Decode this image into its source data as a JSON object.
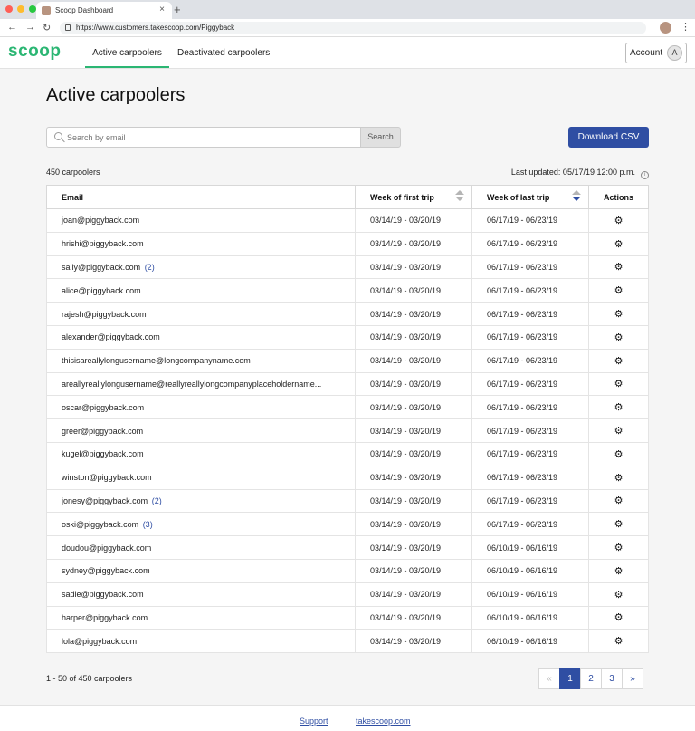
{
  "browser": {
    "tab_title": "Scoop Dashboard",
    "url": "https://www.customers.takescoop.com/Piggyback",
    "new_tab": "+",
    "close": "×",
    "back": "←",
    "forward": "→",
    "reload": "↻",
    "menu": "⋮"
  },
  "header": {
    "logo": "scoop",
    "tabs": [
      {
        "label": "Active carpoolers",
        "active": true
      },
      {
        "label": "Deactivated carpoolers",
        "active": false
      }
    ],
    "account_label": "Account",
    "avatar_initial": "A"
  },
  "page": {
    "title": "Active carpoolers",
    "search": {
      "placeholder": "Search by email",
      "button_label": "Search"
    },
    "download_label": "Download CSV",
    "count_label": "450 carpoolers",
    "last_updated": "Last updated: 05/17/19 12:00 p.m.",
    "info_icon": "i"
  },
  "table": {
    "columns": [
      "Email",
      "Week of first trip",
      "Week of last trip",
      "Actions"
    ],
    "sorted_column": "Week of last trip",
    "sort_direction": "descending",
    "rows": [
      {
        "email": "joan@piggyback.com",
        "count": "",
        "first": "03/14/19 - 03/20/19",
        "last": "06/17/19 - 06/23/19"
      },
      {
        "email": "hrishi@piggyback.com",
        "count": "",
        "first": "03/14/19 - 03/20/19",
        "last": "06/17/19 - 06/23/19"
      },
      {
        "email": "sally@piggyback.com",
        "count": "(2)",
        "first": "03/14/19 - 03/20/19",
        "last": "06/17/19 - 06/23/19"
      },
      {
        "email": "alice@piggyback.com",
        "count": "",
        "first": "03/14/19 - 03/20/19",
        "last": "06/17/19 - 06/23/19"
      },
      {
        "email": "rajesh@piggyback.com",
        "count": "",
        "first": "03/14/19 - 03/20/19",
        "last": "06/17/19 - 06/23/19"
      },
      {
        "email": "alexander@piggyback.com",
        "count": "",
        "first": "03/14/19 - 03/20/19",
        "last": "06/17/19 - 06/23/19"
      },
      {
        "email": "thisisareallylongusername@longcompanyname.com",
        "count": "",
        "first": "03/14/19 - 03/20/19",
        "last": "06/17/19 - 06/23/19"
      },
      {
        "email": "areallyreallylongusername@reallyreallylongcompanyplaceholdername...",
        "count": "",
        "first": "03/14/19 - 03/20/19",
        "last": "06/17/19 - 06/23/19"
      },
      {
        "email": "oscar@piggyback.com",
        "count": "",
        "first": "03/14/19 - 03/20/19",
        "last": "06/17/19 - 06/23/19"
      },
      {
        "email": "greer@piggyback.com",
        "count": "",
        "first": "03/14/19 - 03/20/19",
        "last": "06/17/19 - 06/23/19"
      },
      {
        "email": "kugel@piggyback.com",
        "count": "",
        "first": "03/14/19 - 03/20/19",
        "last": "06/17/19 - 06/23/19"
      },
      {
        "email": "winston@piggyback.com",
        "count": "",
        "first": "03/14/19 - 03/20/19",
        "last": "06/17/19 - 06/23/19"
      },
      {
        "email": "jonesy@piggyback.com",
        "count": "(2)",
        "first": "03/14/19 - 03/20/19",
        "last": "06/17/19 - 06/23/19"
      },
      {
        "email": "oski@piggyback.com",
        "count": "(3)",
        "first": "03/14/19 - 03/20/19",
        "last": "06/17/19 - 06/23/19"
      },
      {
        "email": "doudou@piggyback.com",
        "count": "",
        "first": "03/14/19 - 03/20/19",
        "last": "06/10/19 - 06/16/19"
      },
      {
        "email": "sydney@piggyback.com",
        "count": "",
        "first": "03/14/19 - 03/20/19",
        "last": "06/10/19 - 06/16/19"
      },
      {
        "email": "sadie@piggyback.com",
        "count": "",
        "first": "03/14/19 - 03/20/19",
        "last": "06/10/19 - 06/16/19"
      },
      {
        "email": "harper@piggyback.com",
        "count": "",
        "first": "03/14/19 - 03/20/19",
        "last": "06/10/19 - 06/16/19"
      },
      {
        "email": "lola@piggyback.com",
        "count": "",
        "first": "03/14/19 - 03/20/19",
        "last": "06/10/19 - 06/16/19"
      }
    ],
    "action_icon": "gear-icon",
    "action_glyph": "⚙"
  },
  "pagination": {
    "range_label": "1 - 50 of 450 carpoolers",
    "prev": "«",
    "pages": [
      "1",
      "2",
      "3"
    ],
    "current": "1",
    "next": "»"
  },
  "footer": {
    "links": [
      "Support",
      "takescoop.com"
    ]
  },
  "colors": {
    "brand_green": "#2bb673",
    "accent_blue": "#2f4ea3"
  }
}
